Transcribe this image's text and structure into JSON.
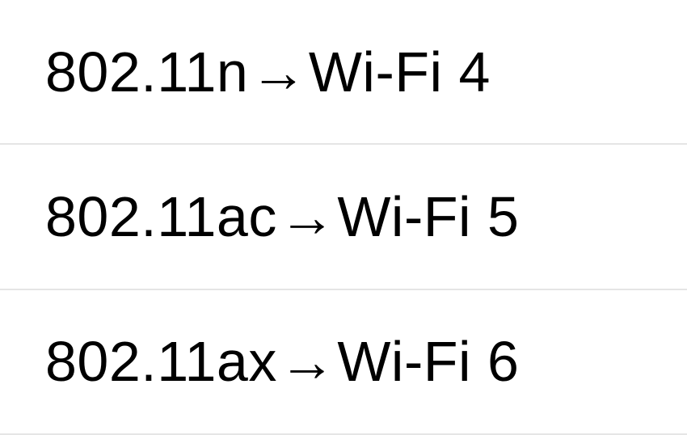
{
  "rows": [
    {
      "standard": "802.11n",
      "arrow": "→",
      "name": "Wi-Fi 4"
    },
    {
      "standard": "802.11ac ",
      "arrow": "→",
      "name": "Wi-Fi 5"
    },
    {
      "standard": "802.11ax ",
      "arrow": "→",
      "name": "Wi-Fi 6"
    }
  ]
}
